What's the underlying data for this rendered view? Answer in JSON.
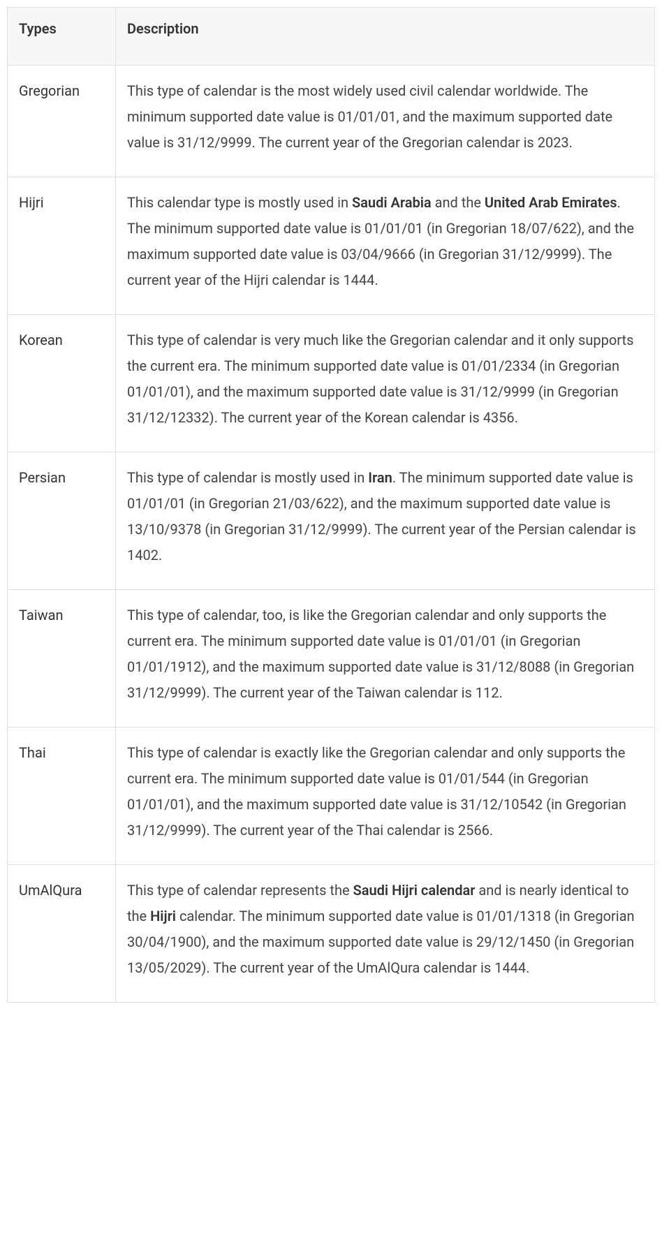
{
  "headers": {
    "types": "Types",
    "description": "Description"
  },
  "rows": [
    {
      "type": "Gregorian",
      "description_html": "This type of calendar is the most widely used civil calendar worldwide. The minimum supported date value is 01/01/01, and the maximum supported date value is 31/12/9999. The current year of the Gregorian calendar is 2023."
    },
    {
      "type": "Hijri",
      "description_html": "This calendar type is mostly used in <strong>Saudi Arabia</strong> and the <strong>United Arab Emirates</strong>. The minimum supported date value is 01/01/01 (in Gregorian 18/07/622), and the maximum supported date value is 03/04/9666 (in Gregorian 31/12/9999). The current year of the Hijri calendar is 1444."
    },
    {
      "type": "Korean",
      "description_html": "This type of calendar is very much like the Gregorian calendar and it only supports the current era. The minimum supported date value is 01/01/2334 (in Gregorian 01/01/01), and the maximum supported date value is 31/12/9999 (in Gregorian 31/12/12332). The current year of the Korean calendar is 4356."
    },
    {
      "type": "Persian",
      "description_html": "This type of calendar is mostly used in <strong>Iran</strong>. The minimum supported date value is 01/01/01 (in Gregorian 21/03/622), and the maximum supported date value is 13/10/9378 (in Gregorian 31/12/9999). The current year of the Persian calendar is 1402."
    },
    {
      "type": "Taiwan",
      "description_html": "This type of calendar, too, is like the Gregorian calendar and only supports the current era. The minimum supported date value is 01/01/01 (in Gregorian 01/01/1912), and the maximum supported date value is 31/12/8088 (in Gregorian 31/12/9999). The current year of the Taiwan calendar is 112."
    },
    {
      "type": "Thai",
      "description_html": "This type of calendar is exactly like the Gregorian calendar and only supports the current era. The minimum supported date value is 01/01/544 (in Gregorian 01/01/01), and the maximum supported date value is 31/12/10542 (in Gregorian 31/12/9999). The current year of the Thai calendar is 2566."
    },
    {
      "type": "UmAlQura",
      "description_html": "This type of calendar represents the <strong>Saudi Hijri calendar</strong> and is nearly identical to the <strong>Hijri</strong> calendar. The minimum supported date value is 01/01/1318 (in Gregorian 30/04/1900), and the maximum supported date value is 29/12/1450 (in Gregorian 13/05/2029). The current year of the  UmAlQura calendar is 1444."
    }
  ]
}
